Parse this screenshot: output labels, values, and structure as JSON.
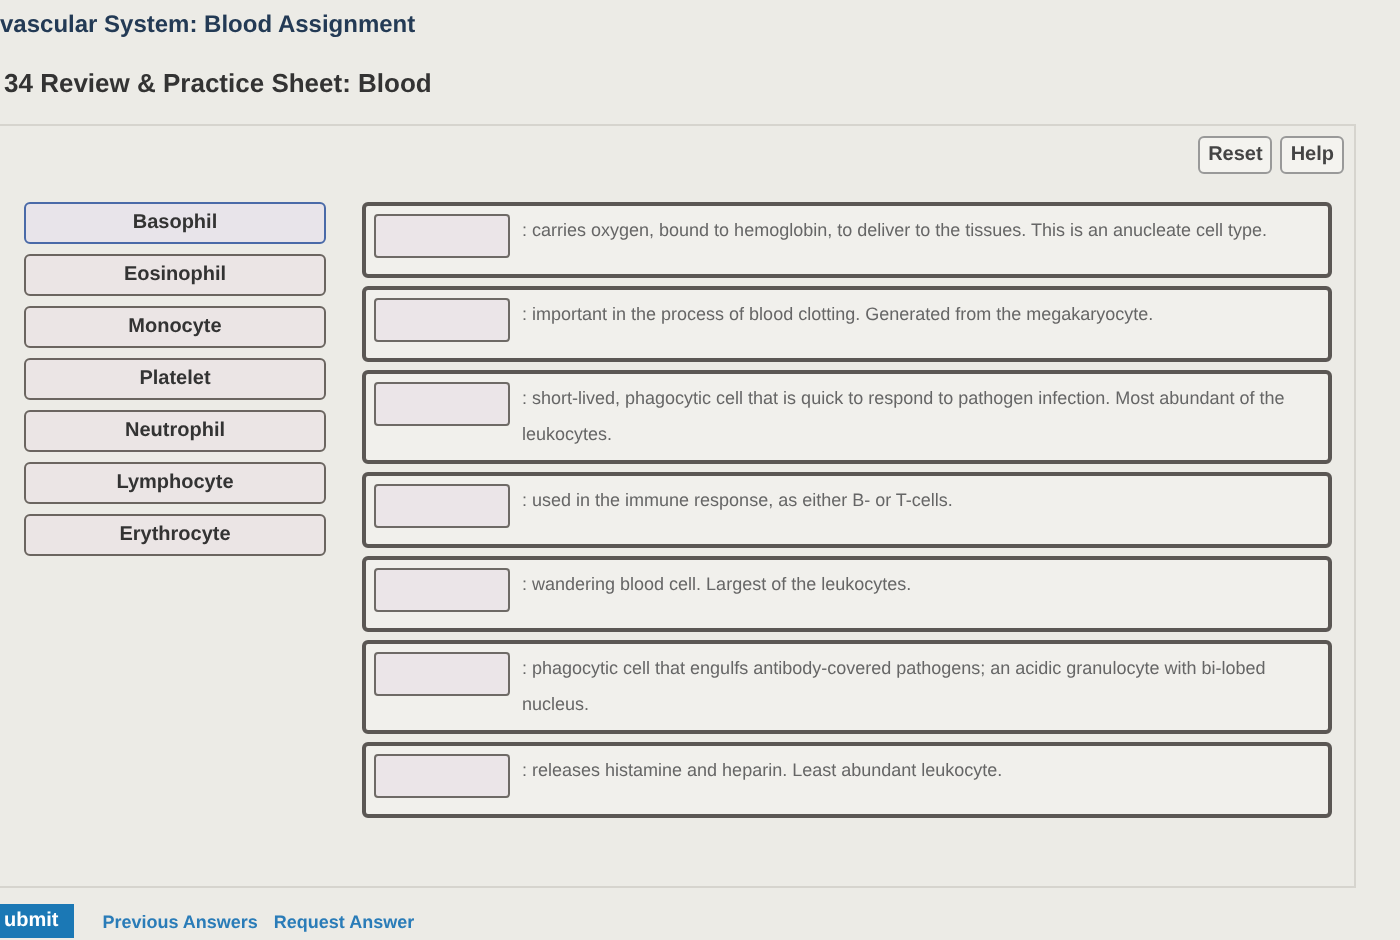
{
  "header": {
    "title": "vascular System: Blood Assignment",
    "subtitle": "34 Review & Practice Sheet: Blood"
  },
  "toolbar": {
    "buttons": [
      "Reset",
      "Help"
    ]
  },
  "labels": [
    {
      "text": "Basophil",
      "selected": true
    },
    {
      "text": "Eosinophil",
      "selected": false
    },
    {
      "text": "Monocyte",
      "selected": false
    },
    {
      "text": "Platelet",
      "selected": false
    },
    {
      "text": "Neutrophil",
      "selected": false
    },
    {
      "text": "Lymphocyte",
      "selected": false
    },
    {
      "text": "Erythrocyte",
      "selected": false
    }
  ],
  "targets": [
    {
      "text": ": carries oxygen, bound to hemoglobin, to deliver to the tissues. This is an anucleate cell type."
    },
    {
      "text": ": important in the process of blood clotting. Generated from the megakaryocyte."
    },
    {
      "text": ": short-lived, phagocytic cell that is quick to respond to pathogen infection. Most abundant of the leukocytes."
    },
    {
      "text": ": used in the immune response, as either B- or T-cells."
    },
    {
      "text": ": wandering blood cell. Largest of the leukocytes."
    },
    {
      "text": ": phagocytic cell that engulfs antibody-covered pathogens; an acidic granulocyte with bi-lobed nucleus."
    },
    {
      "text": ": releases histamine and heparin. Least abundant leukocyte."
    }
  ],
  "footer": {
    "submit": "ubmit",
    "links": [
      "Previous Answers",
      "Request Answer"
    ]
  }
}
